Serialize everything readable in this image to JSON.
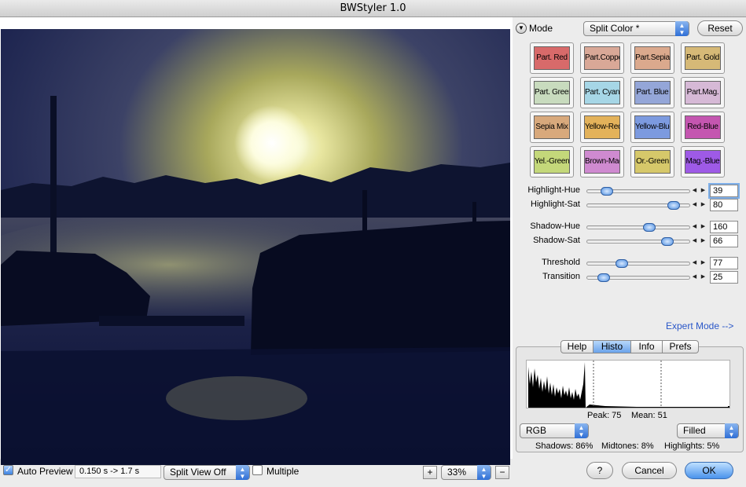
{
  "window": {
    "title": "BWStyler 1.0"
  },
  "mode": {
    "label": "Mode",
    "selected": "Split Color *",
    "reset_label": "Reset"
  },
  "presets": [
    {
      "label": "Part. Red",
      "color": "#d86a6a"
    },
    {
      "label": "Part.Copper",
      "color": "#d9a897"
    },
    {
      "label": "Part.Sepia",
      "color": "#dba98d"
    },
    {
      "label": "Part. Gold",
      "color": "#d6b977"
    },
    {
      "label": "Part. Green",
      "color": "#c8dbbe"
    },
    {
      "label": "Part. Cyan",
      "color": "#a6d6e6"
    },
    {
      "label": "Part. Blue",
      "color": "#94a6d8"
    },
    {
      "label": "Part.Mag.",
      "color": "#d6b9d6"
    },
    {
      "label": "Sepia Mix",
      "color": "#d8a97c"
    },
    {
      "label": "Yellow-Red",
      "color": "#e3b25a"
    },
    {
      "label": "Yellow-Blue",
      "color": "#7c9adf"
    },
    {
      "label": "Red-Blue",
      "color": "#c456b0"
    },
    {
      "label": "Yel.-Green",
      "color": "#c4d87a"
    },
    {
      "label": "Brown-Mag.",
      "color": "#cf8ad0"
    },
    {
      "label": "Or.-Green",
      "color": "#d6c86a"
    },
    {
      "label": "Mag.-Blue",
      "color": "#9e5ae6"
    }
  ],
  "sliders": [
    {
      "label": "Highlight-Hue",
      "value": "39",
      "fraction": 0.19
    },
    {
      "label": "Highlight-Sat",
      "value": "80",
      "fraction": 0.83
    },
    {
      "label": "Shadow-Hue",
      "value": "160",
      "fraction": 0.6
    },
    {
      "label": "Shadow-Sat",
      "value": "66",
      "fraction": 0.77
    },
    {
      "label": "Threshold",
      "value": "77",
      "fraction": 0.33
    },
    {
      "label": "Transition",
      "value": "25",
      "fraction": 0.16
    }
  ],
  "expert_mode_link": "Expert Mode -->",
  "tabs": [
    "Help",
    "Histo",
    "Info",
    "Prefs"
  ],
  "active_tab": "Histo",
  "histogram": {
    "peak_text": "Peak: 75",
    "mean_text": "Mean: 51",
    "channel": "RGB",
    "style": "Filled",
    "shadows_text": "Shadows: 86%",
    "midtones_text": "Midtones: 8%",
    "highlights_text": "Highlights: 5%"
  },
  "bottom": {
    "auto_preview_label": "Auto Preview",
    "timing": "0.150 s -> 1.7 s",
    "split_view": "Split View Off",
    "multiple_label": "Multiple",
    "zoom_in": "+",
    "zoom": "33%",
    "zoom_out": "−",
    "help_label": "?",
    "cancel_label": "Cancel",
    "ok_label": "OK"
  }
}
